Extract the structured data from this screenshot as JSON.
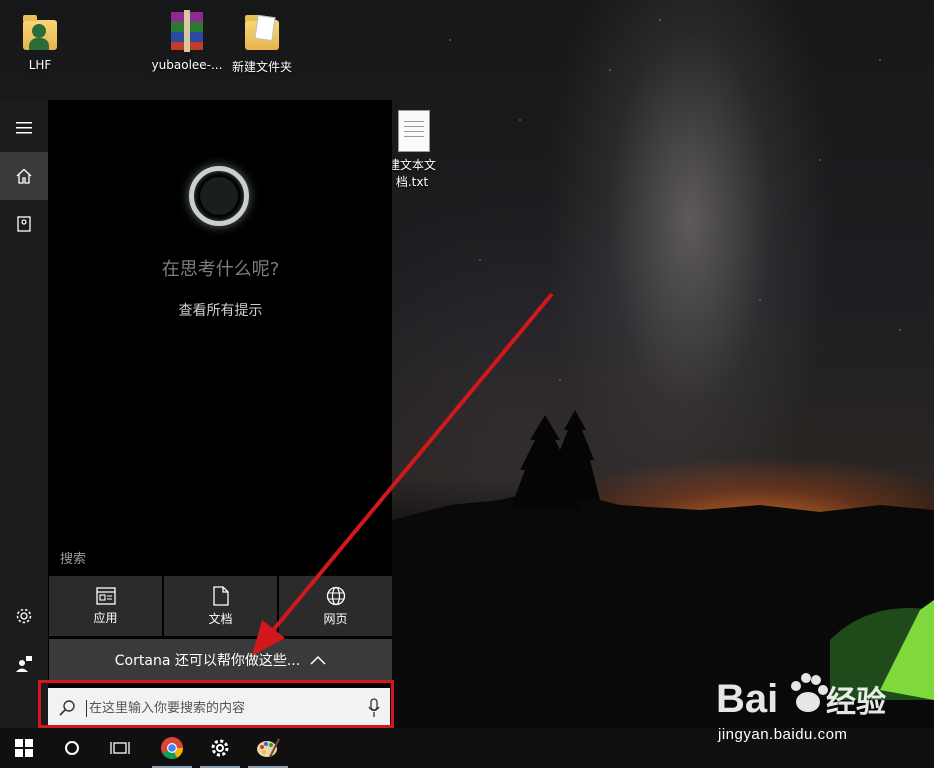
{
  "desktop": {
    "icons": [
      {
        "label": "LHF",
        "type": "user-folder"
      },
      {
        "label": "yubaolee-...",
        "type": "archive"
      },
      {
        "label": "新建文件夹",
        "type": "folder"
      },
      {
        "label_line1": "建文本文",
        "label_line2": "档.txt",
        "type": "text-file"
      }
    ]
  },
  "cortana": {
    "question": "在思考什么呢?",
    "tips_link": "查看所有提示",
    "search_header": "搜索",
    "filters": [
      {
        "label": "应用",
        "icon": "apps-icon"
      },
      {
        "label": "文档",
        "icon": "document-icon"
      },
      {
        "label": "网页",
        "icon": "globe-icon"
      }
    ],
    "help_bar": "Cortana 还可以帮你做这些...",
    "search_placeholder": "在这里输入你要搜索的内容"
  },
  "rail": {
    "items": [
      "hamburger-icon",
      "home-icon",
      "notebook-icon",
      "settings-icon",
      "feedback-icon"
    ]
  },
  "taskbar": {
    "items": [
      "windows-start-icon",
      "cortana-circle-icon",
      "task-view-icon",
      "chrome-icon",
      "settings-gear-icon",
      "paint-icon"
    ]
  },
  "annotation": {
    "highlight_color": "#d2181c",
    "arrow_color": "#d2181c"
  },
  "watermark": {
    "brand": "Baidu经验",
    "url": "jingyan.baidu.com"
  }
}
